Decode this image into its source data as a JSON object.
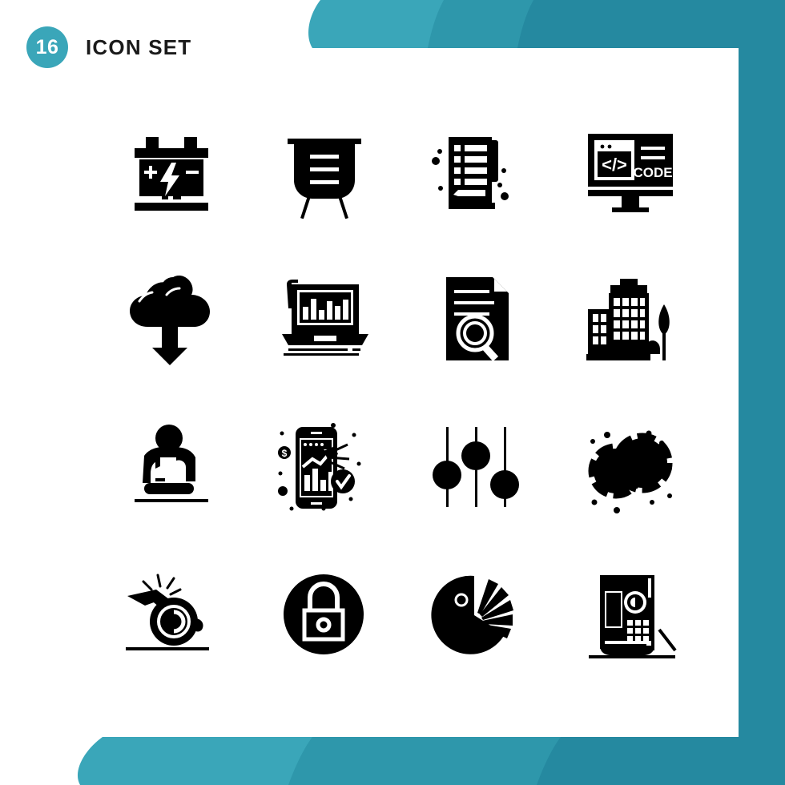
{
  "header": {
    "count": "16",
    "title": "ICON SET"
  },
  "theme": {
    "accent_light": "#3aa6b9",
    "accent_mid": "#2e97ab",
    "accent_dark": "#2589a0",
    "icon_color": "#000000",
    "background": "#ffffff"
  },
  "icons": [
    {
      "id": "car-battery",
      "label": "Car Battery",
      "row": 1,
      "col": 1
    },
    {
      "id": "presentation-board",
      "label": "Presentation Board",
      "row": 1,
      "col": 2
    },
    {
      "id": "checklist-notepad",
      "label": "Checklist Notepad",
      "row": 1,
      "col": 3
    },
    {
      "id": "code-monitor",
      "label": "Code Monitor",
      "row": 1,
      "col": 4,
      "screen_text": "CODE",
      "code_symbol": "</>"
    },
    {
      "id": "cloud-download",
      "label": "Cloud Download",
      "row": 2,
      "col": 1
    },
    {
      "id": "laptop-analytics",
      "label": "Laptop Analytics",
      "row": 2,
      "col": 2
    },
    {
      "id": "document-search",
      "label": "Document Search",
      "row": 2,
      "col": 3
    },
    {
      "id": "city-buildings",
      "label": "City Buildings",
      "row": 2,
      "col": 4
    },
    {
      "id": "cpr-first-aid",
      "label": "CPR First Aid",
      "row": 3,
      "col": 1
    },
    {
      "id": "mobile-analytics",
      "label": "Mobile Analytics",
      "row": 3,
      "col": 2
    },
    {
      "id": "settings-sliders",
      "label": "Settings Sliders",
      "row": 3,
      "col": 3
    },
    {
      "id": "linked-rings",
      "label": "Linked Rings",
      "row": 3,
      "col": 4
    },
    {
      "id": "whistle",
      "label": "Whistle",
      "row": 4,
      "col": 1
    },
    {
      "id": "padlock-circle",
      "label": "Padlock",
      "row": 4,
      "col": 2
    },
    {
      "id": "pie-chart",
      "label": "Pie Chart",
      "row": 4,
      "col": 3
    },
    {
      "id": "safe-vault",
      "label": "Safe Vault",
      "row": 4,
      "col": 4
    }
  ]
}
